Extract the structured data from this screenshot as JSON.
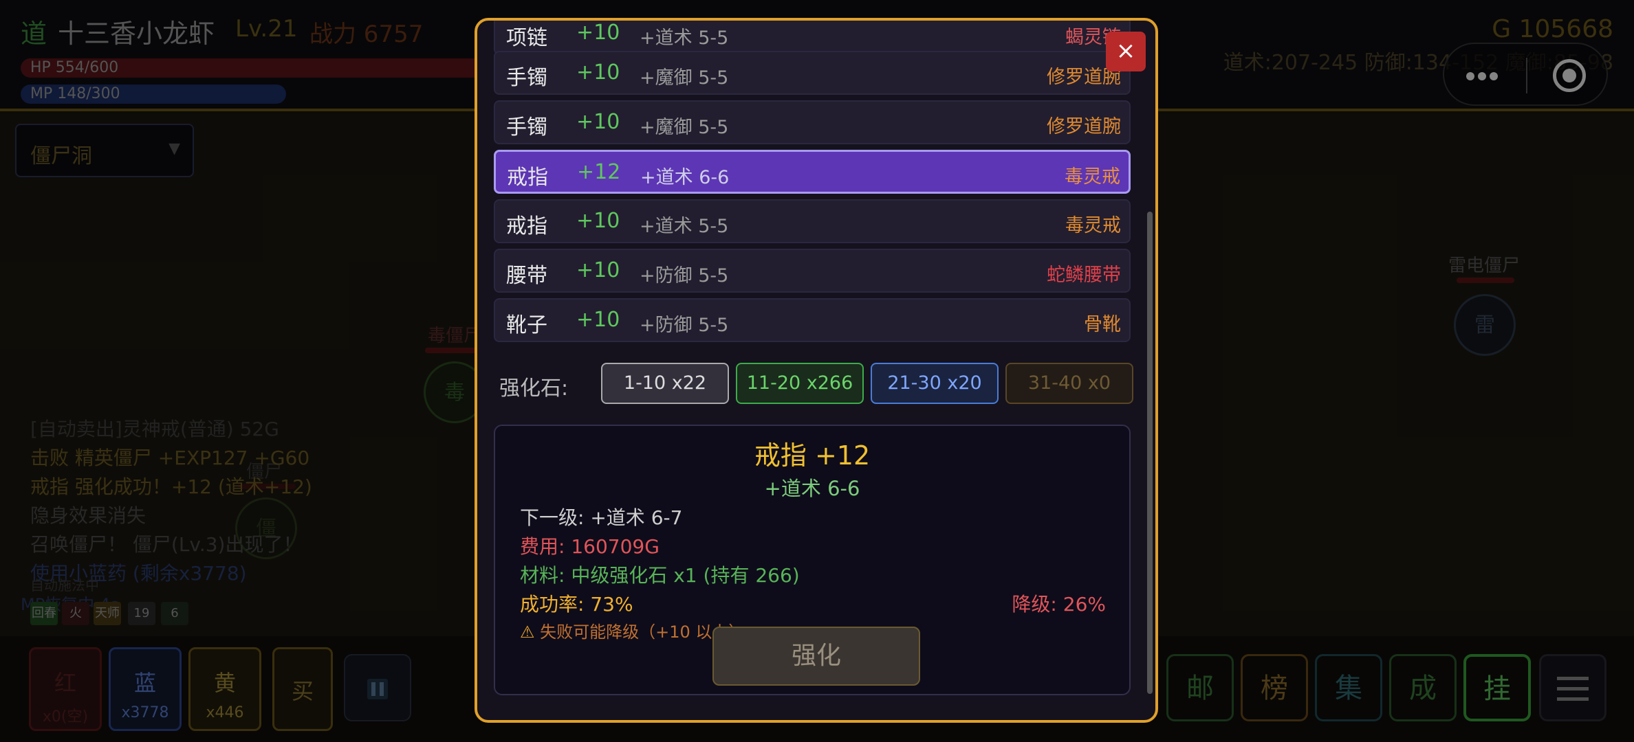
{
  "player": {
    "class_glyph": "道",
    "name": "十三香小龙虾",
    "level": "Lv.21",
    "power": "战力 6757",
    "hp": "HP 554/600",
    "mp": "MP 148/300",
    "gold": "G 105668",
    "stats": "道术:207-245 防御:134-152 魔御:85-98"
  },
  "map": {
    "selected": "僵尸洞"
  },
  "enemies": [
    {
      "name": "雷电僵尸",
      "glyph": "雷"
    },
    {
      "name": "毒僵尸",
      "glyph": "毒"
    },
    {
      "name": "僵尸",
      "glyph": "僵"
    }
  ],
  "log": [
    {
      "text": "[自动卖出]灵神戒(普通) 52G",
      "color": "#3e3e3e"
    },
    {
      "text": "击败 精英僵尸 +EXP127 +G60",
      "color": "#6a5a24"
    },
    {
      "text": "戒指 强化成功！+12 (道术+12)",
      "color": "#6a5a24"
    },
    {
      "text": "隐身效果消失",
      "color": "#4a4a4a"
    },
    {
      "text": "召唤僵尸！ 僵尸(Lv.3)出现了！",
      "color": "#4a4a4a"
    },
    {
      "text": "使用小蓝药 (剩余x3778)",
      "color": "#2a3c70"
    }
  ],
  "log_auto": "自动施法中",
  "log_mp": "MP恢复中 4s",
  "buffs": [
    {
      "label": "回春",
      "color": "#1f4a1f"
    },
    {
      "label": "火",
      "color": "#3a1616"
    },
    {
      "label": "天师",
      "color": "#4a3a14"
    },
    {
      "label": "19",
      "color": "#2a2a2a"
    },
    {
      "label": "6",
      "color": "#1f2a1f"
    }
  ],
  "potions": [
    {
      "label": "红",
      "count": "x0(空)",
      "border": "#5a1818",
      "bg": "#2a1212",
      "color": "#5a2020"
    },
    {
      "label": "蓝",
      "count": "x3778",
      "border": "#2c4690",
      "bg": "#121a2e",
      "color": "#5a7ad0"
    },
    {
      "label": "黄",
      "count": "x446",
      "border": "#6a5418",
      "bg": "#221c0e",
      "color": "#a08a38"
    },
    {
      "label": "买",
      "count": "",
      "border": "#6a5418",
      "bg": "#1e190e",
      "color": "#8a7630"
    }
  ],
  "pause_icon": "pause-icon",
  "actions": [
    {
      "label": "邮",
      "border": "#2a5a2a",
      "color": "#3a7a3a"
    },
    {
      "label": "榜",
      "border": "#6a4a1a",
      "color": "#8a6a2a"
    },
    {
      "label": "集",
      "border": "#1f4a52",
      "color": "#2f6a72"
    },
    {
      "label": "成",
      "border": "#2a5a2a",
      "color": "#3a7a3a"
    },
    {
      "label": "挂",
      "border": "#3aa03a",
      "color": "#5ac05a"
    }
  ],
  "menu_icon": "hamburger-menu-icon",
  "modal": {
    "close_label": "×",
    "equipment": [
      {
        "slot": "项链",
        "level": "+10",
        "stat": "+道术 5-5",
        "item": "蝎灵链",
        "item_color": "#e0555a",
        "selected": false
      },
      {
        "slot": "手镯",
        "level": "+10",
        "stat": "+魔御 5-5",
        "item": "修罗道腕",
        "item_color": "#e08a30",
        "selected": false
      },
      {
        "slot": "手镯",
        "level": "+10",
        "stat": "+魔御 5-5",
        "item": "修罗道腕",
        "item_color": "#e08a30",
        "selected": false
      },
      {
        "slot": "戒指",
        "level": "+12",
        "stat": "+道术 6-6",
        "item": "毒灵戒",
        "item_color": "#e89040",
        "selected": true
      },
      {
        "slot": "戒指",
        "level": "+10",
        "stat": "+道术 5-5",
        "item": "毒灵戒",
        "item_color": "#e08a30",
        "selected": false
      },
      {
        "slot": "腰带",
        "level": "+10",
        "stat": "+防御 5-5",
        "item": "蛇鳞腰带",
        "item_color": "#e0404a",
        "selected": false
      },
      {
        "slot": "靴子",
        "level": "+10",
        "stat": "+防御 5-5",
        "item": "骨靴",
        "item_color": "#e08a30",
        "selected": false
      }
    ],
    "stones_label": "强化石:",
    "stones": [
      {
        "label": "1-10 x22"
      },
      {
        "label": "11-20 x266"
      },
      {
        "label": "21-30 x20"
      },
      {
        "label": "31-40 x0"
      }
    ],
    "detail": {
      "title": "戒指 +12",
      "current": "+道术 6-6",
      "next": "下一级: +道术 6-7",
      "cost": "费用: 160709G",
      "material": "材料: 中级强化石 x1 (持有 266)",
      "success": "成功率: 73%",
      "downgrade": "降级: 26%",
      "warning": "失败可能降级（+10 以上）",
      "button": "强化"
    }
  }
}
